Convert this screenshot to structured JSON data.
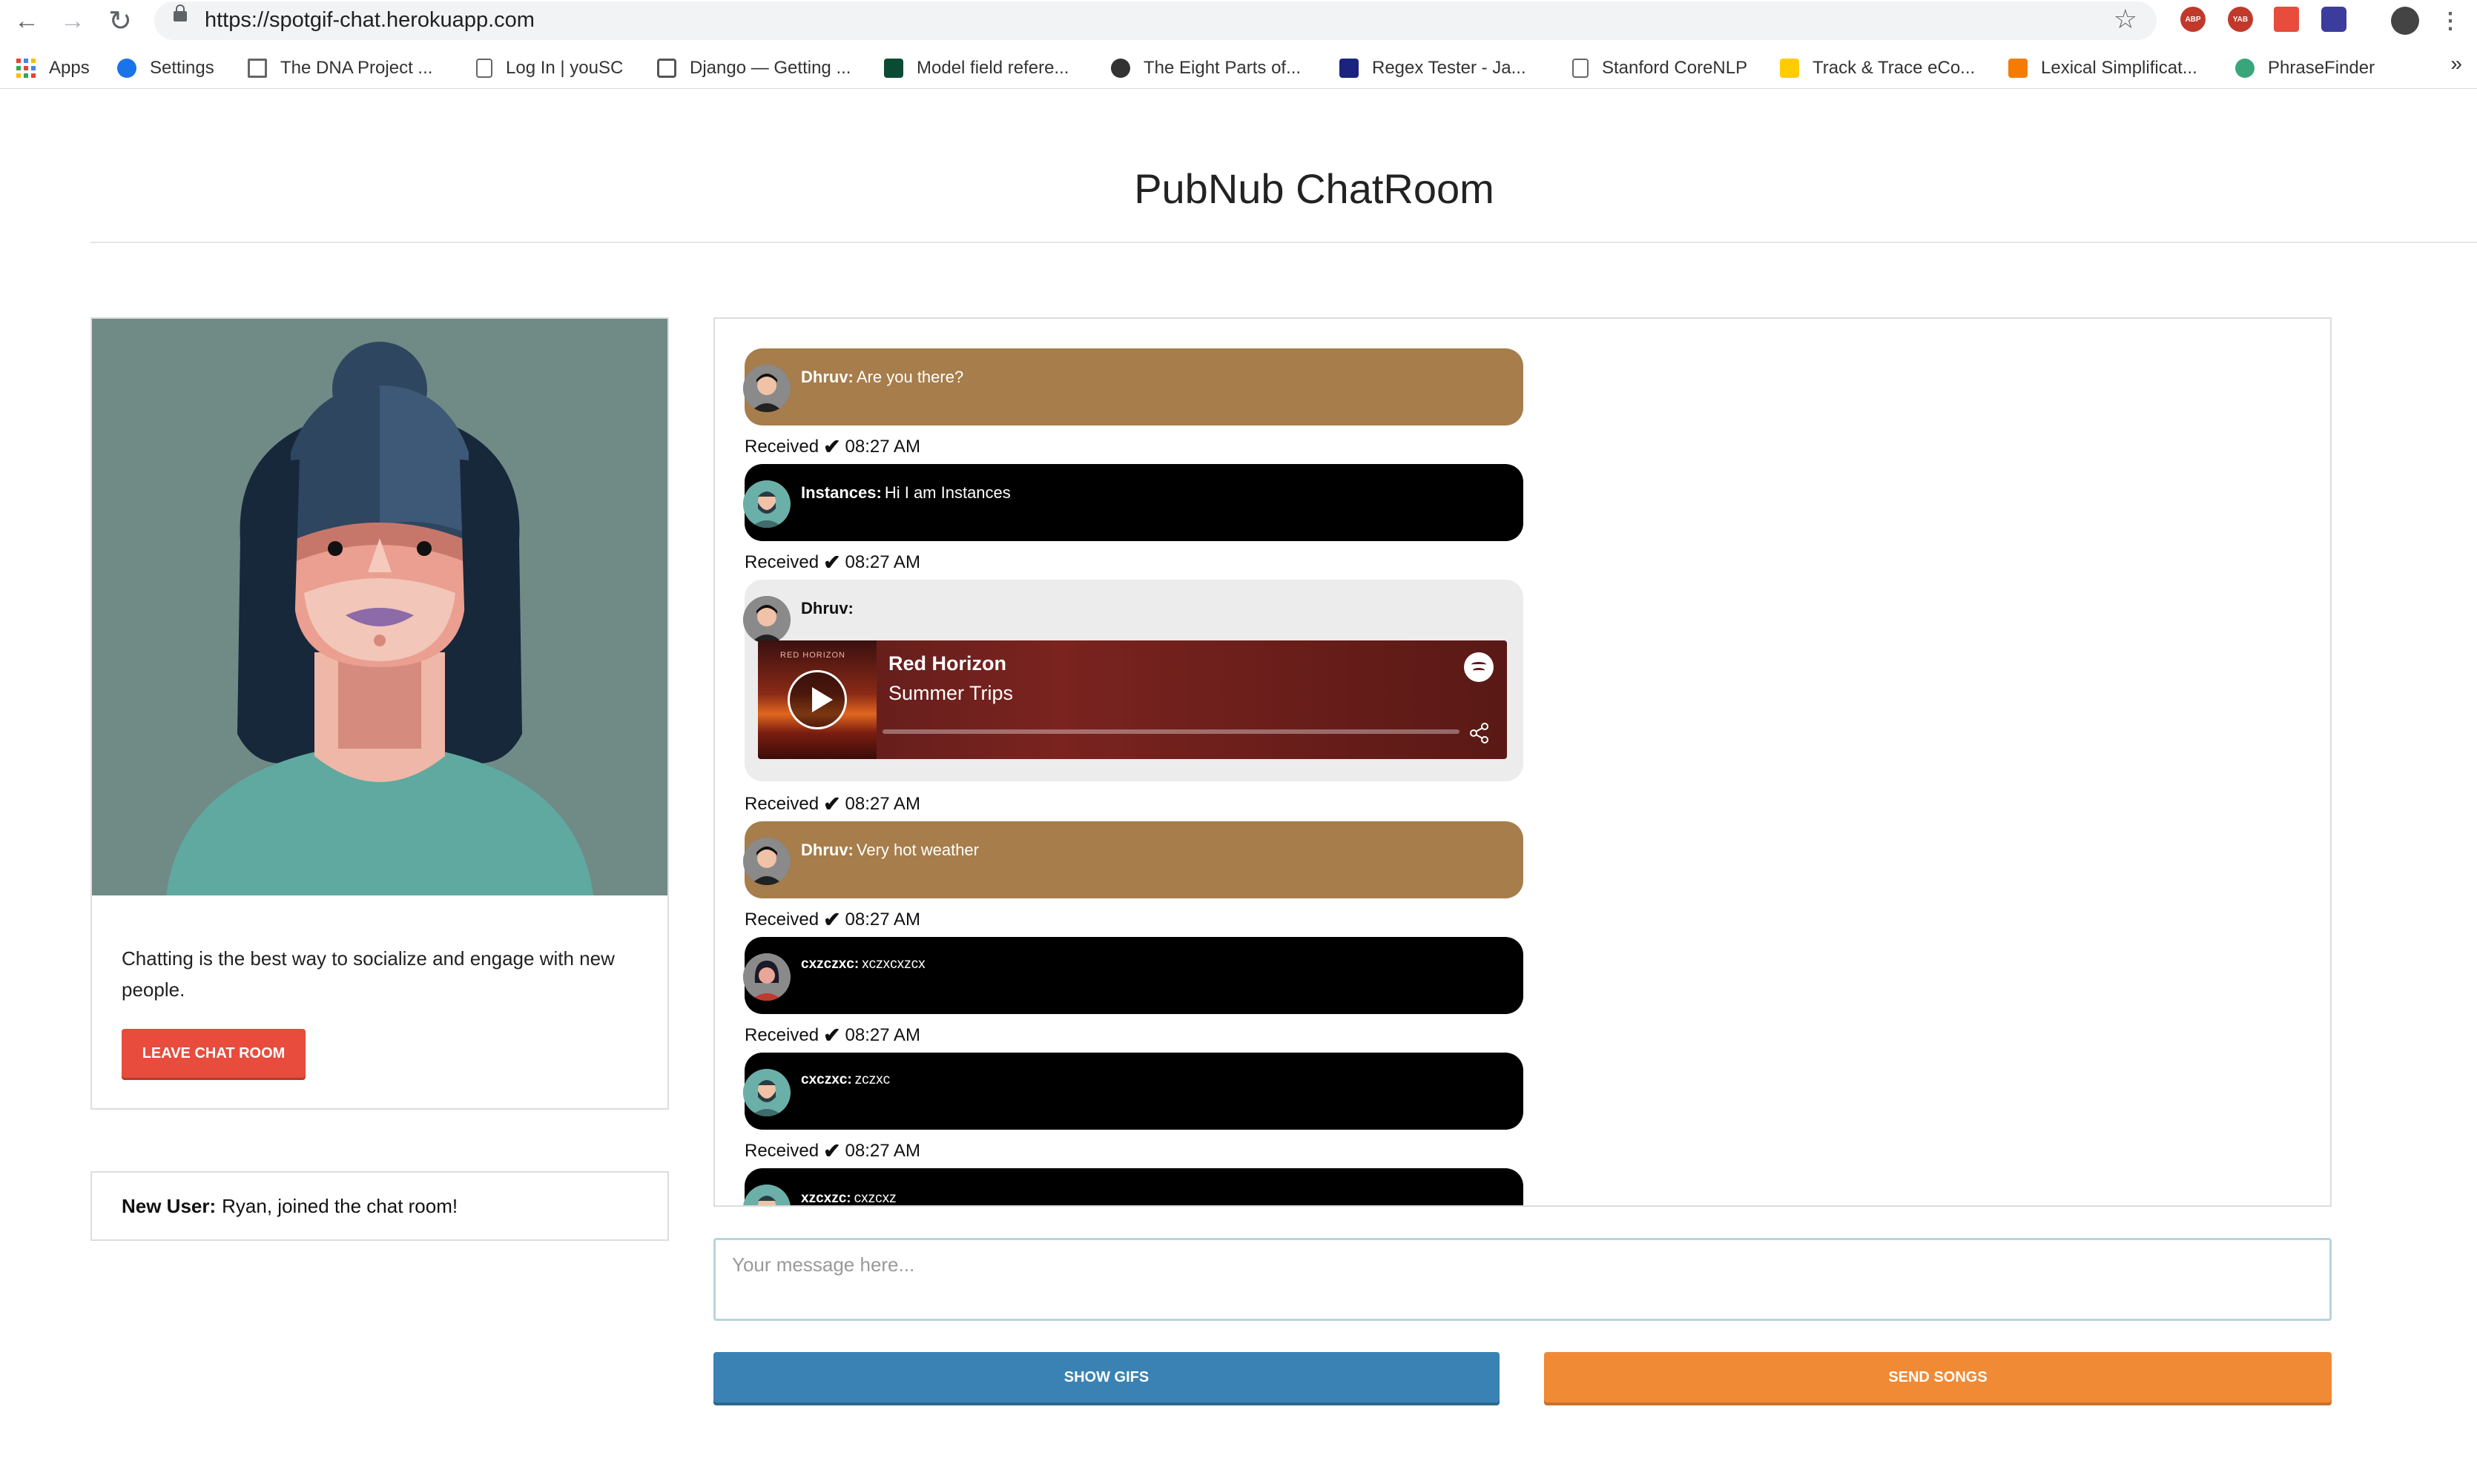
{
  "browser": {
    "url": "https://spotgif-chat.herokuapp.com",
    "bookmarks": [
      {
        "label": "Apps",
        "icon": "apps-grid-icon"
      },
      {
        "label": "Settings",
        "icon": "gear-icon"
      },
      {
        "label": "The DNA Project ...",
        "icon": "dna-icon"
      },
      {
        "label": "Log In | youSC",
        "icon": "page-icon"
      },
      {
        "label": "Django — Getting ...",
        "icon": "django-docs-icon"
      },
      {
        "label": "Model field refere...",
        "icon": "django-icon"
      },
      {
        "label": "The Eight Parts of...",
        "icon": "eight-parts-icon"
      },
      {
        "label": "Regex Tester - Ja...",
        "icon": "regex-icon"
      },
      {
        "label": "Stanford CoreNLP",
        "icon": "page-icon"
      },
      {
        "label": "Track & Trace eCo...",
        "icon": "dhl-icon"
      },
      {
        "label": "Lexical Simplificat...",
        "icon": "blogger-icon"
      },
      {
        "label": "PhraseFinder",
        "icon": "phrasefinder-icon"
      }
    ],
    "more": "»",
    "extensions": [
      {
        "label": "ABP",
        "color": "#c0392b"
      },
      {
        "label": "YAB",
        "color": "#c0392b"
      },
      {
        "label": "",
        "color": "#e74c3c"
      },
      {
        "label": "",
        "color": "#3c3c9c"
      }
    ]
  },
  "page": {
    "title": "PubNub ChatRoom"
  },
  "profile": {
    "description": "Chatting is the best way to socialize and engage with new people.",
    "leave_label": "LEAVE CHAT ROOM"
  },
  "notice": {
    "label": "New User:",
    "text": "Ryan, joined the chat room!"
  },
  "messages": [
    {
      "user": "Dhruv:",
      "text": "Are you there?",
      "style": "tan",
      "avatar": "avatar-man",
      "status": "Received",
      "time": "08:27 AM"
    },
    {
      "user": "Instances:",
      "text": "Hi I am Instances",
      "style": "black",
      "avatar": "avatar-bearded",
      "status": "Received",
      "time": "08:27 AM"
    },
    {
      "user": "Dhruv:",
      "text": "",
      "style": "grey",
      "avatar": "avatar-man",
      "status": "Received",
      "time": "08:27 AM",
      "spotify": {
        "title": "Red Horizon",
        "artist": "Summer Trips",
        "cover_text": "RED HORIZON"
      }
    },
    {
      "user": "Dhruv:",
      "text": "Very hot weather",
      "style": "tan",
      "avatar": "avatar-man",
      "status": "Received",
      "time": "08:27 AM"
    },
    {
      "user": "cxzczxc:",
      "text": "xczxcxzcx",
      "style": "black",
      "avatar": "avatar-woman",
      "status": "Received",
      "time": "08:27 AM"
    },
    {
      "user": "cxczxc:",
      "text": "zczxc",
      "style": "black",
      "avatar": "avatar-bearded",
      "status": "Received",
      "time": "08:27 AM"
    },
    {
      "user": "xzcxzc:",
      "text": "cxzcxz",
      "style": "black",
      "avatar": "avatar-bearded",
      "status": "",
      "time": ""
    }
  ],
  "composer": {
    "placeholder": "Your message here...",
    "gifs_label": "SHOW GIFS",
    "songs_label": "SEND SONGS"
  }
}
